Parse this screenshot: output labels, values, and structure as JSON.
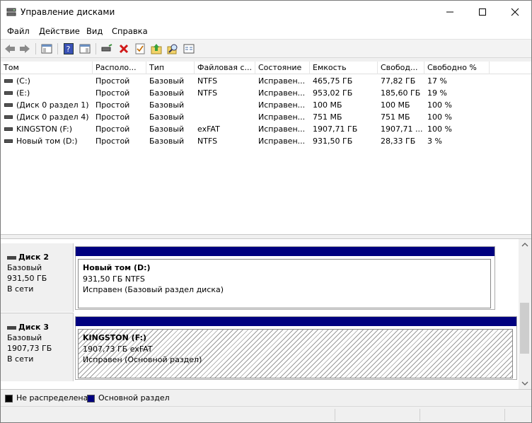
{
  "window": {
    "title": "Управление дисками"
  },
  "menu": [
    "Файл",
    "Действие",
    "Вид",
    "Справка"
  ],
  "columns": [
    "Том",
    "Располо...",
    "Тип",
    "Файловая с...",
    "Состояние",
    "Емкость",
    "Свобод...",
    "Свободно %"
  ],
  "volumes": [
    {
      "name": "(C:)",
      "layout": "Простой",
      "type": "Базовый",
      "fs": "NTFS",
      "status": "Исправен...",
      "capacity": "465,75 ГБ",
      "free": "77,82 ГБ",
      "free_pct": "17 %"
    },
    {
      "name": "(E:)",
      "layout": "Простой",
      "type": "Базовый",
      "fs": "NTFS",
      "status": "Исправен...",
      "capacity": "953,02 ГБ",
      "free": "185,60 ГБ",
      "free_pct": "19 %"
    },
    {
      "name": "(Диск 0 раздел 1)",
      "layout": "Простой",
      "type": "Базовый",
      "fs": "",
      "status": "Исправен...",
      "capacity": "100 МБ",
      "free": "100 МБ",
      "free_pct": "100 %"
    },
    {
      "name": "(Диск 0 раздел 4)",
      "layout": "Простой",
      "type": "Базовый",
      "fs": "",
      "status": "Исправен...",
      "capacity": "751 МБ",
      "free": "751 МБ",
      "free_pct": "100 %"
    },
    {
      "name": "KINGSTON (F:)",
      "layout": "Простой",
      "type": "Базовый",
      "fs": "exFAT",
      "status": "Исправен...",
      "capacity": "1907,71 ГБ",
      "free": "1907,71 ...",
      "free_pct": "100 %"
    },
    {
      "name": "Новый том (D:)",
      "layout": "Простой",
      "type": "Базовый",
      "fs": "NTFS",
      "status": "Исправен...",
      "capacity": "931,50 ГБ",
      "free": "28,33 ГБ",
      "free_pct": "3 %"
    }
  ],
  "disks": [
    {
      "name": "Диск 2",
      "kind": "Базовый",
      "size": "931,50 ГБ",
      "state": "В сети",
      "partition": {
        "title": "Новый том  (D:)",
        "size_fs": "931,50 ГБ NTFS",
        "status": "Исправен (Базовый раздел диска)"
      }
    },
    {
      "name": "Диск 3",
      "kind": "Базовый",
      "size": "1907,73 ГБ",
      "state": "В сети",
      "partition": {
        "title": "KINGSTON  (F:)",
        "size_fs": "1907,73 ГБ exFAT",
        "status": "Исправен (Основной раздел)"
      }
    }
  ],
  "legend": {
    "unallocated": "Не распределена",
    "primary": "Основной раздел"
  },
  "colors": {
    "primary_partition": "#00007f",
    "unallocated": "#000000"
  },
  "toolbar_icons": [
    "back-icon",
    "forward-icon",
    "console-tree-icon",
    "help-icon",
    "action-pane-icon",
    "connect-disk-icon",
    "delete-icon",
    "check-icon",
    "folder-up-icon",
    "search-icon",
    "properties-icon"
  ]
}
